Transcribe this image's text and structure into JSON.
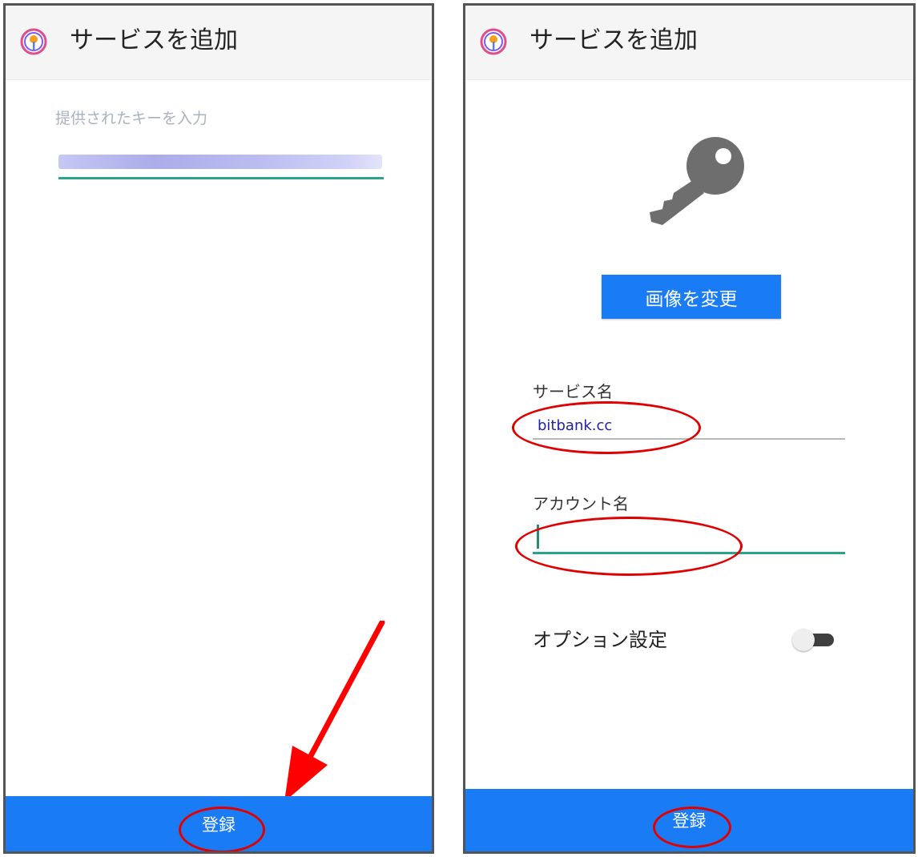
{
  "colors": {
    "accent": "#1a7cf5",
    "underline_focus": "#2aa38a",
    "annotation_red": "#e00000"
  },
  "left_screen": {
    "title": "サービスを追加",
    "key_input": {
      "label": "提供されたキーを入力"
    },
    "register_label": "登録"
  },
  "right_screen": {
    "title": "サービスを追加",
    "service_icon": "key-icon",
    "change_image_label": "画像を変更",
    "service_name": {
      "label": "サービス名",
      "value": "bitbank.cc"
    },
    "account_name": {
      "label": "アカウント名",
      "value": ""
    },
    "option_settings": {
      "label": "オプション設定",
      "enabled": false
    },
    "register_label": "登録"
  }
}
